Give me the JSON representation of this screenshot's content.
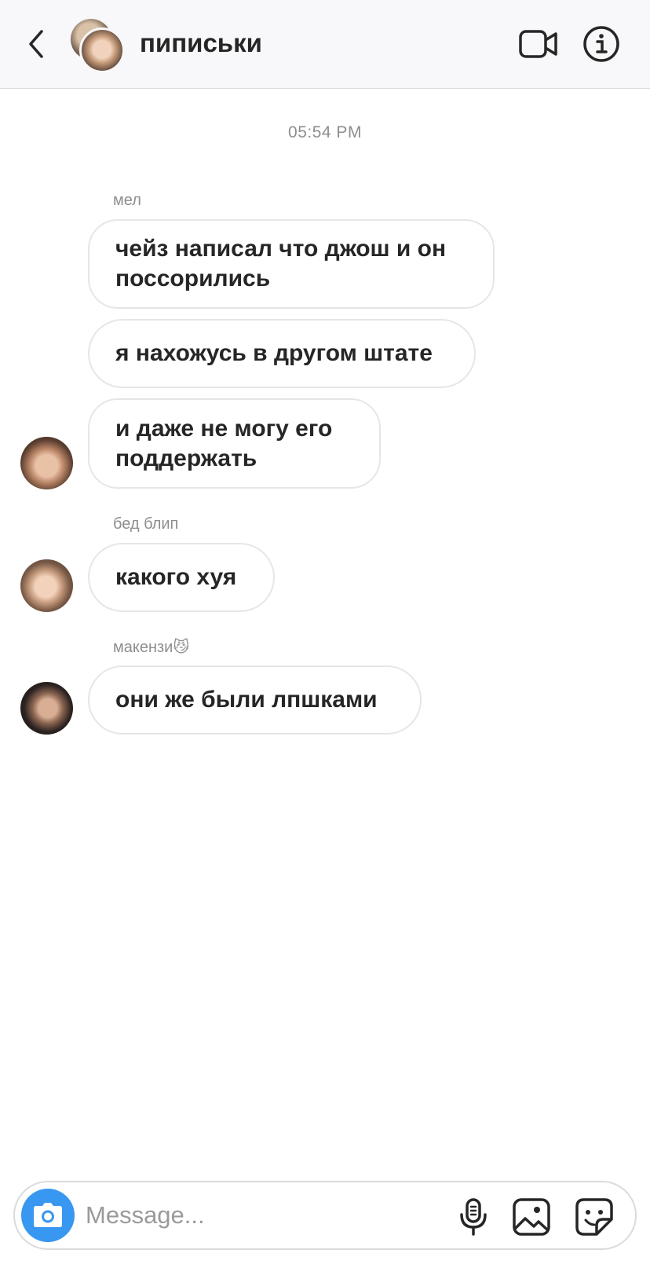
{
  "header": {
    "title": "пиписьки",
    "back_icon": "chevron-left-icon",
    "video_icon": "video-camera-icon",
    "info_icon": "info-icon"
  },
  "thread": {
    "timestamp": "05:54 PM",
    "groups": [
      {
        "sender": "мел",
        "messages": [
          "чейз написал что джош и он поссорились",
          "я нахожусь в другом штате",
          "и даже не могу его поддержать"
        ]
      },
      {
        "sender": "бед блип",
        "messages": [
          "какого хуя"
        ]
      },
      {
        "sender": "макензи😼",
        "messages": [
          "они же были лпшками"
        ]
      }
    ]
  },
  "composer": {
    "placeholder": "Message...",
    "camera_icon": "camera-icon",
    "mic_icon": "microphone-icon",
    "gallery_icon": "image-icon",
    "sticker_icon": "sticker-icon",
    "accent_color": "#3897f0"
  }
}
